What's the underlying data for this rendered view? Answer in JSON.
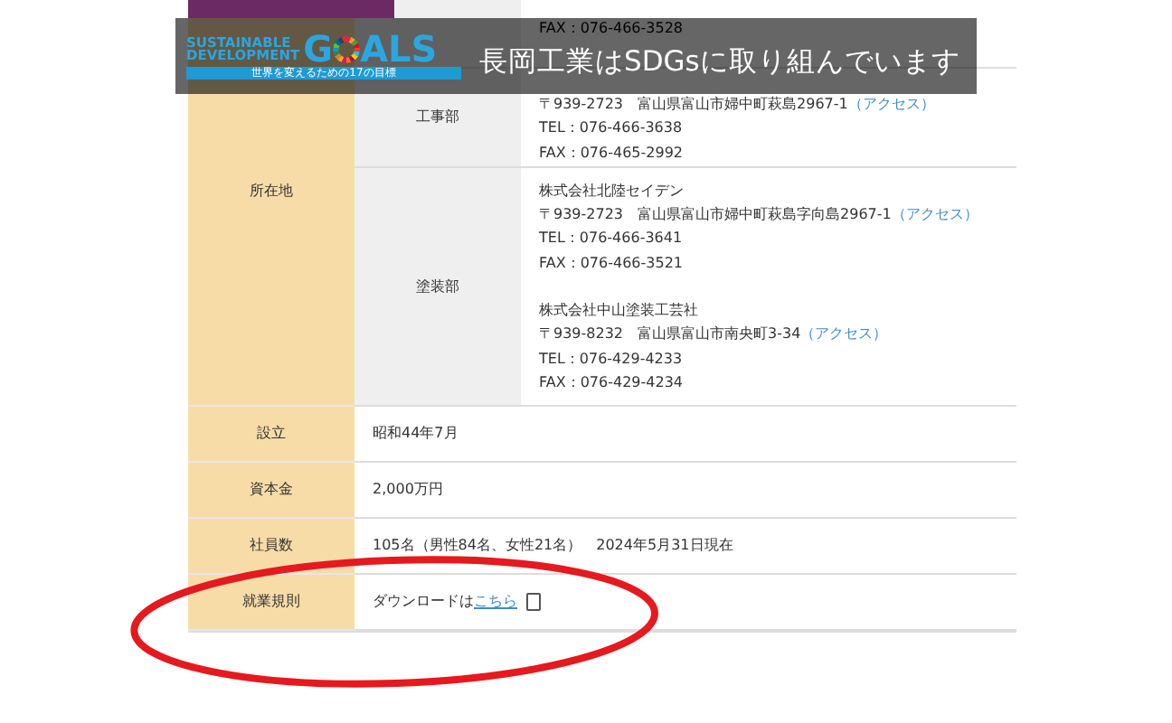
{
  "banner": {
    "logo": {
      "line1": "SUSTAINABLE",
      "line2": "DEVELOPMENT",
      "goals_left": "G",
      "goals_right": "ALS",
      "tagline": "世界を変えるための17の目標"
    },
    "text": "長岡工業はSDGsに取り組んでいます"
  },
  "location": {
    "label": "所在地",
    "departments": [
      {
        "entries": [
          {
            "fax": "FAX：076-466-3528"
          }
        ]
      },
      {
        "name": "工事部",
        "entries": [
          {
            "address": "〒939-2723　富山県富山市婦中町萩島2967-1",
            "access": "（アクセス）",
            "tel": "TEL：076-466-3638",
            "fax": "FAX：076-465-2992"
          }
        ]
      },
      {
        "name": "塗装部",
        "entries": [
          {
            "company": "株式会社北陸セイデン",
            "address": "〒939-2723　富山県富山市婦中町萩島字向島2967-1",
            "access": "（アクセス）",
            "tel": "TEL：076-466-3641",
            "fax": "FAX：076-466-3521"
          },
          {
            "company": "株式会社中山塗装工芸社",
            "address": "〒939-8232　富山県富山市南央町3-34",
            "access": "（アクセス）",
            "tel": "TEL：076-429-4233",
            "fax": "FAX：076-429-4234"
          }
        ]
      }
    ]
  },
  "rows": [
    {
      "kind": "text",
      "label": "設立",
      "value": "昭和44年7月"
    },
    {
      "kind": "text",
      "label": "資本金",
      "value": "2,000万円"
    },
    {
      "kind": "text",
      "label": "社員数",
      "value": "105名（男性84名、女性21名）　2024年5月31日現在"
    },
    {
      "kind": "download",
      "label": "就業規則",
      "value": "ダウンロードは",
      "link": "こちら"
    }
  ]
}
